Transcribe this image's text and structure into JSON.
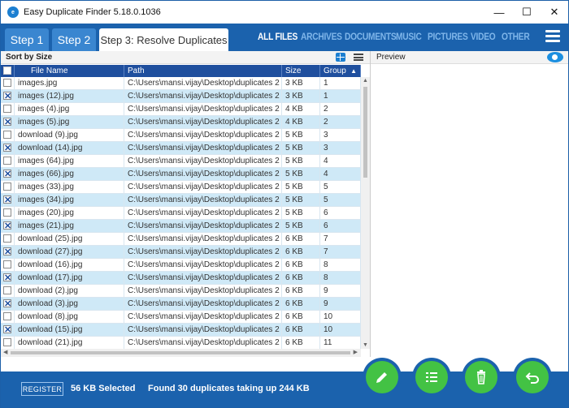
{
  "window": {
    "title": "Easy Duplicate Finder 5.18.0.1036",
    "minimize": "—",
    "maximize": "☐",
    "close": "✕"
  },
  "steps": [
    {
      "label": "Step 1"
    },
    {
      "label": "Step 2"
    },
    {
      "label": "Step 3: Resolve Duplicates"
    }
  ],
  "categories": [
    "ALL FILES",
    "ARCHIVES",
    "DOCUMENTS",
    "MUSIC",
    "PICTURES",
    "VIDEO",
    "OTHER"
  ],
  "active_category": "ALL FILES",
  "sortbar": {
    "label": "Sort by Size"
  },
  "preview": {
    "label": "Preview"
  },
  "table": {
    "columns": [
      "File Name",
      "Path",
      "Size",
      "Group"
    ],
    "sort_indicator": "▲",
    "rows": [
      {
        "name": "images.jpg",
        "path": "C:\\Users\\mansi.vijay\\Desktop\\duplicates 2",
        "size": "3 KB",
        "group": "1",
        "checked": false
      },
      {
        "name": "images (12).jpg",
        "path": "C:\\Users\\mansi.vijay\\Desktop\\duplicates 2",
        "size": "3 KB",
        "group": "1",
        "checked": true
      },
      {
        "name": "images (4).jpg",
        "path": "C:\\Users\\mansi.vijay\\Desktop\\duplicates 2",
        "size": "4 KB",
        "group": "2",
        "checked": false
      },
      {
        "name": "images (5).jpg",
        "path": "C:\\Users\\mansi.vijay\\Desktop\\duplicates 2",
        "size": "4 KB",
        "group": "2",
        "checked": true
      },
      {
        "name": "download (9).jpg",
        "path": "C:\\Users\\mansi.vijay\\Desktop\\duplicates 2",
        "size": "5 KB",
        "group": "3",
        "checked": false
      },
      {
        "name": "download (14).jpg",
        "path": "C:\\Users\\mansi.vijay\\Desktop\\duplicates 2",
        "size": "5 KB",
        "group": "3",
        "checked": true
      },
      {
        "name": "images (64).jpg",
        "path": "C:\\Users\\mansi.vijay\\Desktop\\duplicates 2",
        "size": "5 KB",
        "group": "4",
        "checked": false
      },
      {
        "name": "images (66).jpg",
        "path": "C:\\Users\\mansi.vijay\\Desktop\\duplicates 2",
        "size": "5 KB",
        "group": "4",
        "checked": true
      },
      {
        "name": "images (33).jpg",
        "path": "C:\\Users\\mansi.vijay\\Desktop\\duplicates 2",
        "size": "5 KB",
        "group": "5",
        "checked": false
      },
      {
        "name": "images (34).jpg",
        "path": "C:\\Users\\mansi.vijay\\Desktop\\duplicates 2",
        "size": "5 KB",
        "group": "5",
        "checked": true
      },
      {
        "name": "images (20).jpg",
        "path": "C:\\Users\\mansi.vijay\\Desktop\\duplicates 2",
        "size": "5 KB",
        "group": "6",
        "checked": false
      },
      {
        "name": "images (21).jpg",
        "path": "C:\\Users\\mansi.vijay\\Desktop\\duplicates 2",
        "size": "5 KB",
        "group": "6",
        "checked": true
      },
      {
        "name": "download (25).jpg",
        "path": "C:\\Users\\mansi.vijay\\Desktop\\duplicates 2",
        "size": "6 KB",
        "group": "7",
        "checked": false
      },
      {
        "name": "download (27).jpg",
        "path": "C:\\Users\\mansi.vijay\\Desktop\\duplicates 2",
        "size": "6 KB",
        "group": "7",
        "checked": true
      },
      {
        "name": "download (16).jpg",
        "path": "C:\\Users\\mansi.vijay\\Desktop\\duplicates 2",
        "size": "6 KB",
        "group": "8",
        "checked": false
      },
      {
        "name": "download (17).jpg",
        "path": "C:\\Users\\mansi.vijay\\Desktop\\duplicates 2",
        "size": "6 KB",
        "group": "8",
        "checked": true
      },
      {
        "name": "download (2).jpg",
        "path": "C:\\Users\\mansi.vijay\\Desktop\\duplicates 2",
        "size": "6 KB",
        "group": "9",
        "checked": false
      },
      {
        "name": "download (3).jpg",
        "path": "C:\\Users\\mansi.vijay\\Desktop\\duplicates 2",
        "size": "6 KB",
        "group": "9",
        "checked": true
      },
      {
        "name": "download (8).jpg",
        "path": "C:\\Users\\mansi.vijay\\Desktop\\duplicates 2",
        "size": "6 KB",
        "group": "10",
        "checked": false
      },
      {
        "name": "download (15).jpg",
        "path": "C:\\Users\\mansi.vijay\\Desktop\\duplicates 2",
        "size": "6 KB",
        "group": "10",
        "checked": true
      },
      {
        "name": "download (21).jpg",
        "path": "C:\\Users\\mansi.vijay\\Desktop\\duplicates 2",
        "size": "6 KB",
        "group": "11",
        "checked": false
      }
    ]
  },
  "footer": {
    "register": "REGISTER",
    "selected": "56 KB Selected",
    "found": "Found 30 duplicates taking up 244 KB"
  },
  "colors": {
    "brand_blue": "#1b62ad",
    "header_blue": "#1f4f9e",
    "row_highlight": "#cfe9f7",
    "action_green": "#43c244"
  },
  "actions": [
    "pencil-icon",
    "list-icon",
    "trash-icon",
    "undo-icon"
  ]
}
